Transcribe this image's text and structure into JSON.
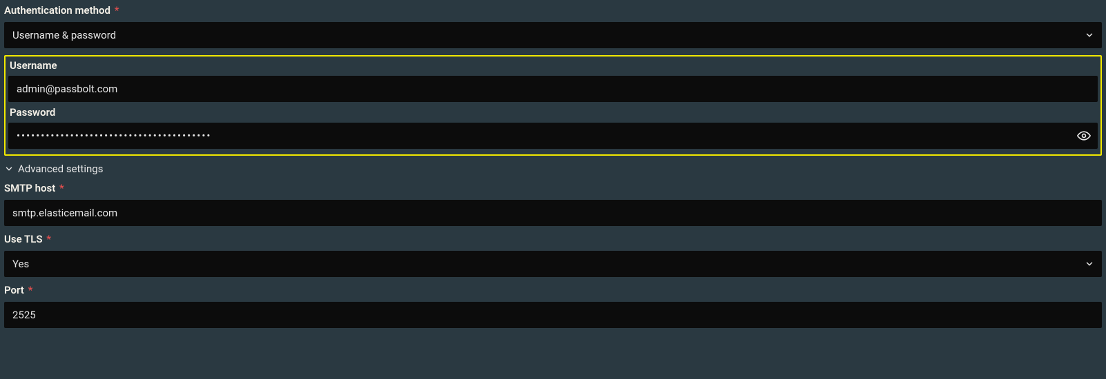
{
  "auth_method": {
    "label": "Authentication method",
    "value": "Username & password"
  },
  "credentials": {
    "username_label": "Username",
    "username_value": "admin@passbolt.com",
    "password_label": "Password",
    "password_value": "••••••••••••••••••••••••••••••••••••••••"
  },
  "advanced_label": "Advanced settings",
  "smtp_host": {
    "label": "SMTP host",
    "value": "smtp.elasticemail.com"
  },
  "use_tls": {
    "label": "Use TLS",
    "value": "Yes"
  },
  "port": {
    "label": "Port",
    "value": "2525"
  }
}
